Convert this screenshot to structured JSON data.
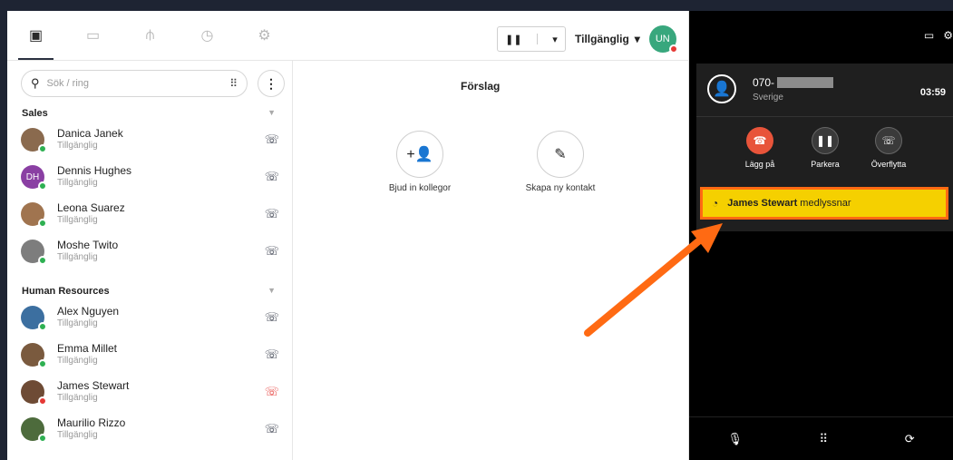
{
  "header": {
    "tabs": [
      {
        "icon": "contacts-icon",
        "glyph": "▣",
        "active": true
      },
      {
        "icon": "chat-icon",
        "glyph": "▭"
      },
      {
        "icon": "org-chart-icon",
        "glyph": "⫛"
      },
      {
        "icon": "history-icon",
        "glyph": "◷"
      },
      {
        "icon": "settings-icon",
        "glyph": "⚙"
      }
    ],
    "pause_glyph": "❚❚",
    "caret_glyph": "▾",
    "status": "Tillgänglig",
    "user_initials": "UN"
  },
  "sidebar": {
    "search_placeholder": "Sök / ring",
    "groups": [
      {
        "name": "Sales",
        "contacts": [
          {
            "name": "Danica Janek",
            "status": "Tillgänglig",
            "status_color": "#2eb052"
          },
          {
            "name": "Dennis Hughes",
            "status": "Tillgänglig",
            "initials": "DH",
            "status_color": "#2eb052"
          },
          {
            "name": "Leona Suarez",
            "status": "Tillgänglig",
            "status_color": "#2eb052"
          },
          {
            "name": "Moshe Twito",
            "status": "Tillgänglig",
            "status_color": "#2eb052"
          }
        ]
      },
      {
        "name": "Human Resources",
        "contacts": [
          {
            "name": "Alex Nguyen",
            "status": "Tillgänglig",
            "status_color": "#2eb052"
          },
          {
            "name": "Emma Millet",
            "status": "Tillgänglig",
            "status_color": "#2eb052"
          },
          {
            "name": "James Stewart",
            "status": "Tillgänglig",
            "status_color": "#e53935"
          },
          {
            "name": "Maurilio Rizzo",
            "status": "Tillgänglig",
            "status_color": "#2eb052"
          }
        ]
      }
    ]
  },
  "main": {
    "title": "Förslag",
    "actions": [
      {
        "label": "Bjud in kollegor",
        "icon": "add-user-icon"
      },
      {
        "label": "Skapa ny kontakt",
        "icon": "pencil-icon"
      }
    ]
  },
  "call": {
    "number_prefix": "070-",
    "country": "Sverige",
    "timer": "03:59",
    "buttons": [
      {
        "label": "Lägg på",
        "icon": "hangup-icon"
      },
      {
        "label": "Parkera",
        "icon": "pause-icon"
      },
      {
        "label": "Överflytta",
        "icon": "transfer-icon"
      }
    ],
    "listener_name": "James Stewart",
    "listener_text": "medlyssnar"
  },
  "colors": {
    "accent_dark": "#2b3140",
    "available": "#2eb052",
    "busy": "#e53935",
    "highlight_yellow": "#f5d000",
    "annotation_orange": "#ff6a13"
  }
}
